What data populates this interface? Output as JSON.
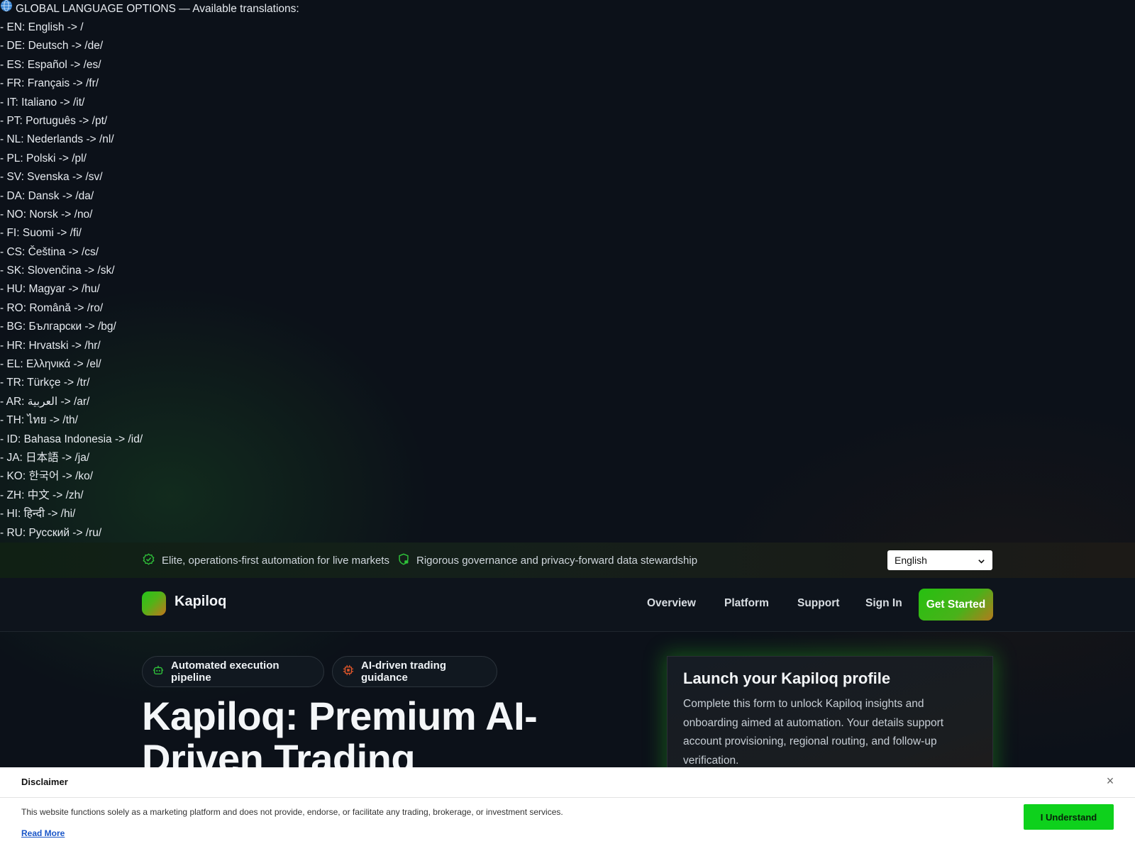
{
  "languages": {
    "heading": "GLOBAL LANGUAGE OPTIONS — Available translations:",
    "items": [
      "- EN: English -> /",
      "- DE: Deutsch -> /de/",
      "- ES: Español -> /es/",
      "- FR: Français -> /fr/",
      "- IT: Italiano -> /it/",
      "- PT: Português -> /pt/",
      "- NL: Nederlands -> /nl/",
      "- PL: Polski -> /pl/",
      "- SV: Svenska -> /sv/",
      "- DA: Dansk -> /da/",
      "- NO: Norsk -> /no/",
      "- FI: Suomi -> /fi/",
      "- CS: Čeština -> /cs/",
      "- SK: Slovenčina -> /sk/",
      "- HU: Magyar -> /hu/",
      "- RO: Română -> /ro/",
      "- BG: Български -> /bg/",
      "- HR: Hrvatski -> /hr/",
      "- EL: Ελληνικά -> /el/",
      "- TR: Türkçe -> /tr/",
      "- AR: العربية -> /ar/",
      "- TH: ไทย -> /th/",
      "- ID: Bahasa Indonesia -> /id/",
      "- JA: 日本語 -> /ja/",
      "- KO: 한국어 -> /ko/",
      "- ZH: 中文 -> /zh/",
      "- HI: हिन्दी -> /hi/",
      "- RU: Русский -> /ru/"
    ]
  },
  "topbar": {
    "item1": "Elite, operations-first automation for live markets",
    "item2": "Rigorous governance and privacy-forward data stewardship",
    "language_selected": "English"
  },
  "nav": {
    "brand": "Kapiloq",
    "links": [
      "Overview",
      "Platform",
      "Support",
      "Sign In"
    ],
    "cta": "Get Started"
  },
  "hero": {
    "pill1": "Automated execution pipeline",
    "pill2": "AI-driven trading guidance",
    "title": "Kapiloq: Premium AI-Driven Trading"
  },
  "card": {
    "title": "Launch your Kapiloq profile",
    "text": "Complete this form to unlock Kapiloq insights and onboarding aimed at automation. Your details support account provisioning, regional routing, and follow-up verification."
  },
  "disclaimer": {
    "title": "Disclaimer",
    "close": "×",
    "text": "This website functions solely as a marketing platform and does not provide, endorse, or facilitate any trading, brokerage, or investment services.",
    "read_more": "Read More",
    "button": "I Understand"
  },
  "colors": {
    "background": "#0c1119",
    "accent_green": "#26c010",
    "accent_orange": "#c6741b",
    "disclaimer_button": "#0ed11c"
  },
  "icons": {
    "globe": "globe-icon",
    "badge_check": "badge-check-icon",
    "shield": "shield-icon",
    "robot": "robot-icon",
    "chip": "chip-icon",
    "chevron": "chevron-down-icon",
    "close": "close-icon"
  }
}
